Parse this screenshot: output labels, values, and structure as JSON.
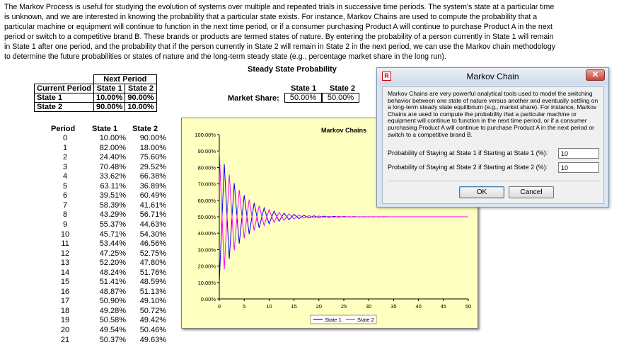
{
  "intro_text": "The Markov Process is useful for studying the evolution of systems over multiple and repeated trials in successive time periods. The system's state at a particular time is unknown, and we are interested in knowing the probability that a particular state exists. For instance, Markov Chains are used to compute the probability that a particular machine or equipment will continue to function in the next time period, or if a consumer purchasing Product A will continue to purchase Product A in the next period or switch to a competitive brand B. These brands or products are termed states of nature. By entering the probability of a person currently in State 1 will remain in State 1 after one period, and the probability that if the person currently in State 2 will remain in State 2 in the next period, we can use the Markov chain methodology to determine the future probabilities or states of nature and the long-term steady state (e.g., percentage market share in the long run).",
  "matrix": {
    "next_period": "Next Period",
    "current_period": "Current Period",
    "col1": "State 1",
    "col2": "State 2",
    "rows": [
      {
        "label": "State 1",
        "v1": "10.00%",
        "v2": "90.00%"
      },
      {
        "label": "State 2",
        "v1": "90.00%",
        "v2": "10.00%"
      }
    ]
  },
  "steady_state": {
    "title": "Steady State Probability",
    "col1": "State 1",
    "col2": "State 2",
    "market_share_label": "Market Share:",
    "s1": "50.00%",
    "s2": "50.00%"
  },
  "periods": {
    "h_period": "Period",
    "h_s1": "State 1",
    "h_s2": "State 2",
    "rows": [
      [
        "0",
        "10.00%",
        "90.00%"
      ],
      [
        "1",
        "82.00%",
        "18.00%"
      ],
      [
        "2",
        "24.40%",
        "75.60%"
      ],
      [
        "3",
        "70.48%",
        "29.52%"
      ],
      [
        "4",
        "33.62%",
        "66.38%"
      ],
      [
        "5",
        "63.11%",
        "36.89%"
      ],
      [
        "6",
        "39.51%",
        "60.49%"
      ],
      [
        "7",
        "58.39%",
        "41.61%"
      ],
      [
        "8",
        "43.29%",
        "56.71%"
      ],
      [
        "9",
        "55.37%",
        "44.63%"
      ],
      [
        "10",
        "45.71%",
        "54.30%"
      ],
      [
        "11",
        "53.44%",
        "46.56%"
      ],
      [
        "12",
        "47.25%",
        "52.75%"
      ],
      [
        "13",
        "52.20%",
        "47.80%"
      ],
      [
        "14",
        "48.24%",
        "51.76%"
      ],
      [
        "15",
        "51.41%",
        "48.59%"
      ],
      [
        "16",
        "48.87%",
        "51.13%"
      ],
      [
        "17",
        "50.90%",
        "49.10%"
      ],
      [
        "18",
        "49.28%",
        "50.72%"
      ],
      [
        "19",
        "50.58%",
        "49.42%"
      ],
      [
        "20",
        "49.54%",
        "50.46%"
      ],
      [
        "21",
        "50.37%",
        "49.63%"
      ]
    ]
  },
  "chart_data": {
    "type": "line",
    "title": "Markov Chains",
    "xlabel": "",
    "ylabel": "",
    "xlim": [
      0,
      50
    ],
    "ylim": [
      0,
      100
    ],
    "x_ticks": [
      0,
      5,
      10,
      15,
      20,
      25,
      30,
      35,
      40,
      45,
      50
    ],
    "y_ticks": [
      "0.00%",
      "10.00%",
      "20.00%",
      "30.00%",
      "40.00%",
      "50.00%",
      "60.00%",
      "70.00%",
      "80.00%",
      "90.00%",
      "100.00%"
    ],
    "legend_position": "bottom",
    "grid": false,
    "x": [
      0,
      1,
      2,
      3,
      4,
      5,
      6,
      7,
      8,
      9,
      10,
      11,
      12,
      13,
      14,
      15,
      16,
      17,
      18,
      19,
      20,
      21,
      22,
      23,
      24,
      25,
      26,
      27,
      28,
      29,
      30,
      31,
      32,
      33,
      34,
      35,
      36,
      37,
      38,
      39,
      40,
      41,
      42,
      43,
      44,
      45,
      46,
      47,
      48,
      49,
      50
    ],
    "series": [
      {
        "name": "State 1",
        "color": "#0000ff",
        "values": [
          10.0,
          82.0,
          24.4,
          70.48,
          33.62,
          63.11,
          39.51,
          58.39,
          43.29,
          55.37,
          45.71,
          53.44,
          47.25,
          52.2,
          48.24,
          51.41,
          48.87,
          50.9,
          49.28,
          50.58,
          49.54,
          50.37,
          49.7,
          50.24,
          49.81,
          50.15,
          49.88,
          50.1,
          49.92,
          50.06,
          49.95,
          50.04,
          49.97,
          50.03,
          49.98,
          50.02,
          49.99,
          50.01,
          49.99,
          50.01,
          50.0,
          50.0,
          50.0,
          50.0,
          50.0,
          50.0,
          50.0,
          50.0,
          50.0,
          50.0,
          50.0
        ]
      },
      {
        "name": "State 2",
        "color": "#ff00ff",
        "values": [
          90.0,
          18.0,
          75.6,
          29.52,
          66.38,
          36.89,
          60.49,
          41.61,
          56.71,
          44.63,
          54.3,
          46.56,
          52.75,
          47.8,
          51.76,
          48.59,
          51.13,
          49.1,
          50.72,
          49.42,
          50.46,
          49.63,
          50.3,
          49.76,
          50.19,
          49.85,
          50.12,
          49.9,
          50.08,
          49.94,
          50.05,
          49.96,
          50.03,
          49.97,
          50.02,
          49.98,
          50.01,
          49.99,
          50.01,
          49.99,
          50.0,
          50.0,
          50.0,
          50.0,
          50.0,
          50.0,
          50.0,
          50.0,
          50.0,
          50.0,
          50.0
        ]
      }
    ]
  },
  "dialog": {
    "title": "Markov Chain",
    "close_glyph": "✕",
    "app_glyph": "R",
    "description": "Markov Chains are very powerful analytical tools used to model the switching behavior between one state of nature versus another and eventually settling on a long-term steady state equilibrium (e.g., market share). For instance, Markov Chains are used to compute the probability that a particular machine or equipment will continue to function in the next time period, or if a consumer purchasing Product A will continue to purchase Product A in the next period or switch to a competitive brand B.",
    "p1_label": "Probability of Staying at State 1 if Starting at State 1 (%):",
    "p1_value": "10",
    "p2_label": "Probability of Staying at State 2 if Starting at State 2 (%):",
    "p2_value": "10",
    "ok": "OK",
    "cancel": "Cancel"
  }
}
